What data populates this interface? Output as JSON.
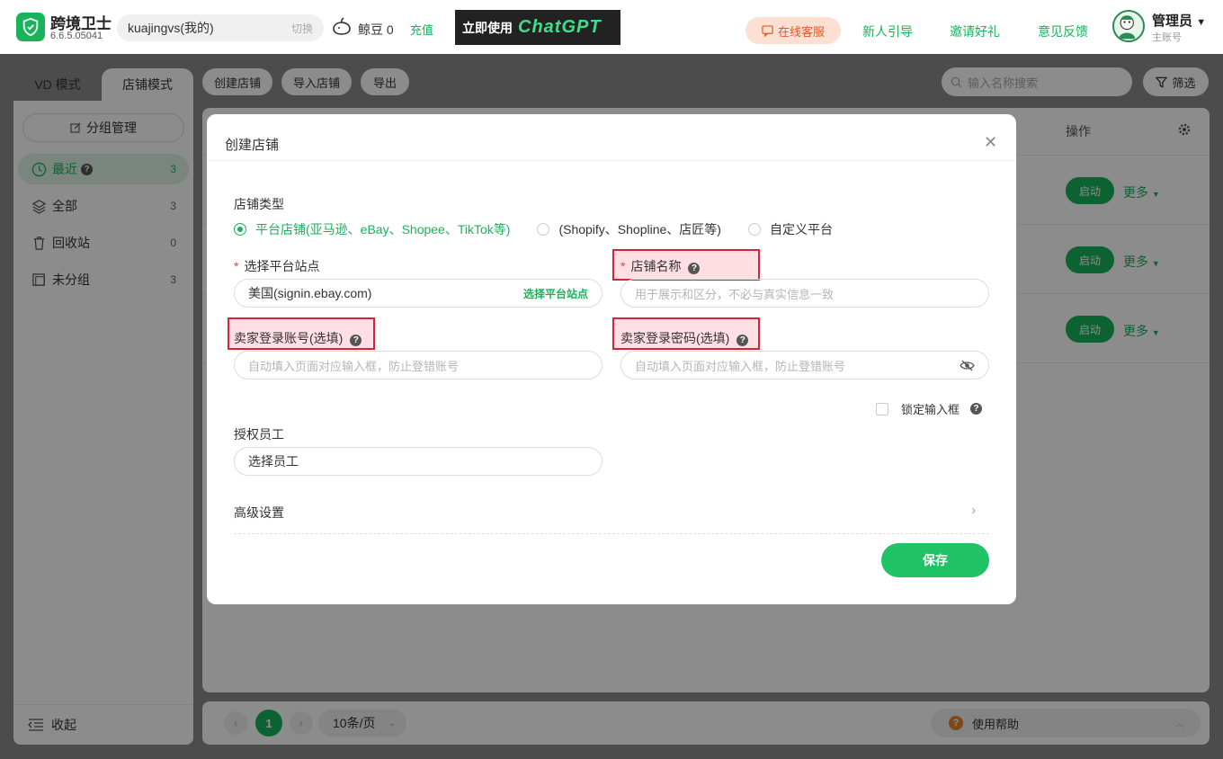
{
  "app": {
    "name": "跨境卫士",
    "version": "6.6.5.05041",
    "account": "kuajingvs(我的)",
    "switch_label": "切换",
    "beans": "鲸豆 0",
    "recharge_label": "充值",
    "banner_text_1": "立即使用",
    "banner_text_2": "ChatGPT",
    "service_label": "在线客服",
    "links": [
      "新人引导",
      "邀请好礼",
      "意见反馈"
    ],
    "admin_name": "管理员",
    "admin_sub": "主账号"
  },
  "sidebar": {
    "tab_vd": "VD 模式",
    "tab_shop": "店铺模式",
    "group_manage": "分组管理",
    "items": [
      {
        "label": "最近",
        "count": "3"
      },
      {
        "label": "全部",
        "count": "3"
      },
      {
        "label": "回收站",
        "count": "0"
      },
      {
        "label": "未分组",
        "count": "3"
      }
    ],
    "collapse_label": "收起"
  },
  "toolbar": {
    "create": "创建店铺",
    "import": "导入店铺",
    "export": "导出",
    "search_placeholder": "输入名称搜索",
    "filter": "筛选"
  },
  "table": {
    "ops_header": "操作",
    "rows": [
      {
        "start": "启动",
        "more": "更多"
      },
      {
        "start": "启动",
        "more": "更多"
      },
      {
        "start": "启动",
        "more": "更多"
      }
    ]
  },
  "pager": {
    "page": "1",
    "page_size": "10条/页",
    "help": "使用帮助"
  },
  "modal": {
    "title": "创建店铺",
    "shop_type_label": "店铺类型",
    "shop_types": [
      {
        "label": "平台店铺(亚马逊、eBay、Shopee、TikTok等)",
        "selected": true
      },
      {
        "label": "(Shopify、Shopline、店匠等)",
        "selected": false
      },
      {
        "label": "自定义平台",
        "selected": false
      }
    ],
    "site_label": "选择平台站点",
    "site_value": "美国(signin.ebay.com)",
    "site_action": "选择平台站点",
    "shop_name_label": "店铺名称",
    "shop_name_placeholder": "用于展示和区分，不必与真实信息一致",
    "seller_account_label": "卖家登录账号(选填)",
    "seller_account_placeholder": "自动填入页面对应输入框，防止登错账号",
    "seller_password_label": "卖家登录密码(选填)",
    "seller_password_placeholder": "自动填入页面对应输入框，防止登错账号",
    "lock_label": "锁定输入框",
    "staff_label": "授权员工",
    "staff_value": "选择员工",
    "advanced_label": "高级设置",
    "save_label": "保存"
  },
  "colors": {
    "accent": "#19b35a",
    "highlight_border": "#d8223a",
    "required": "#e64545"
  }
}
